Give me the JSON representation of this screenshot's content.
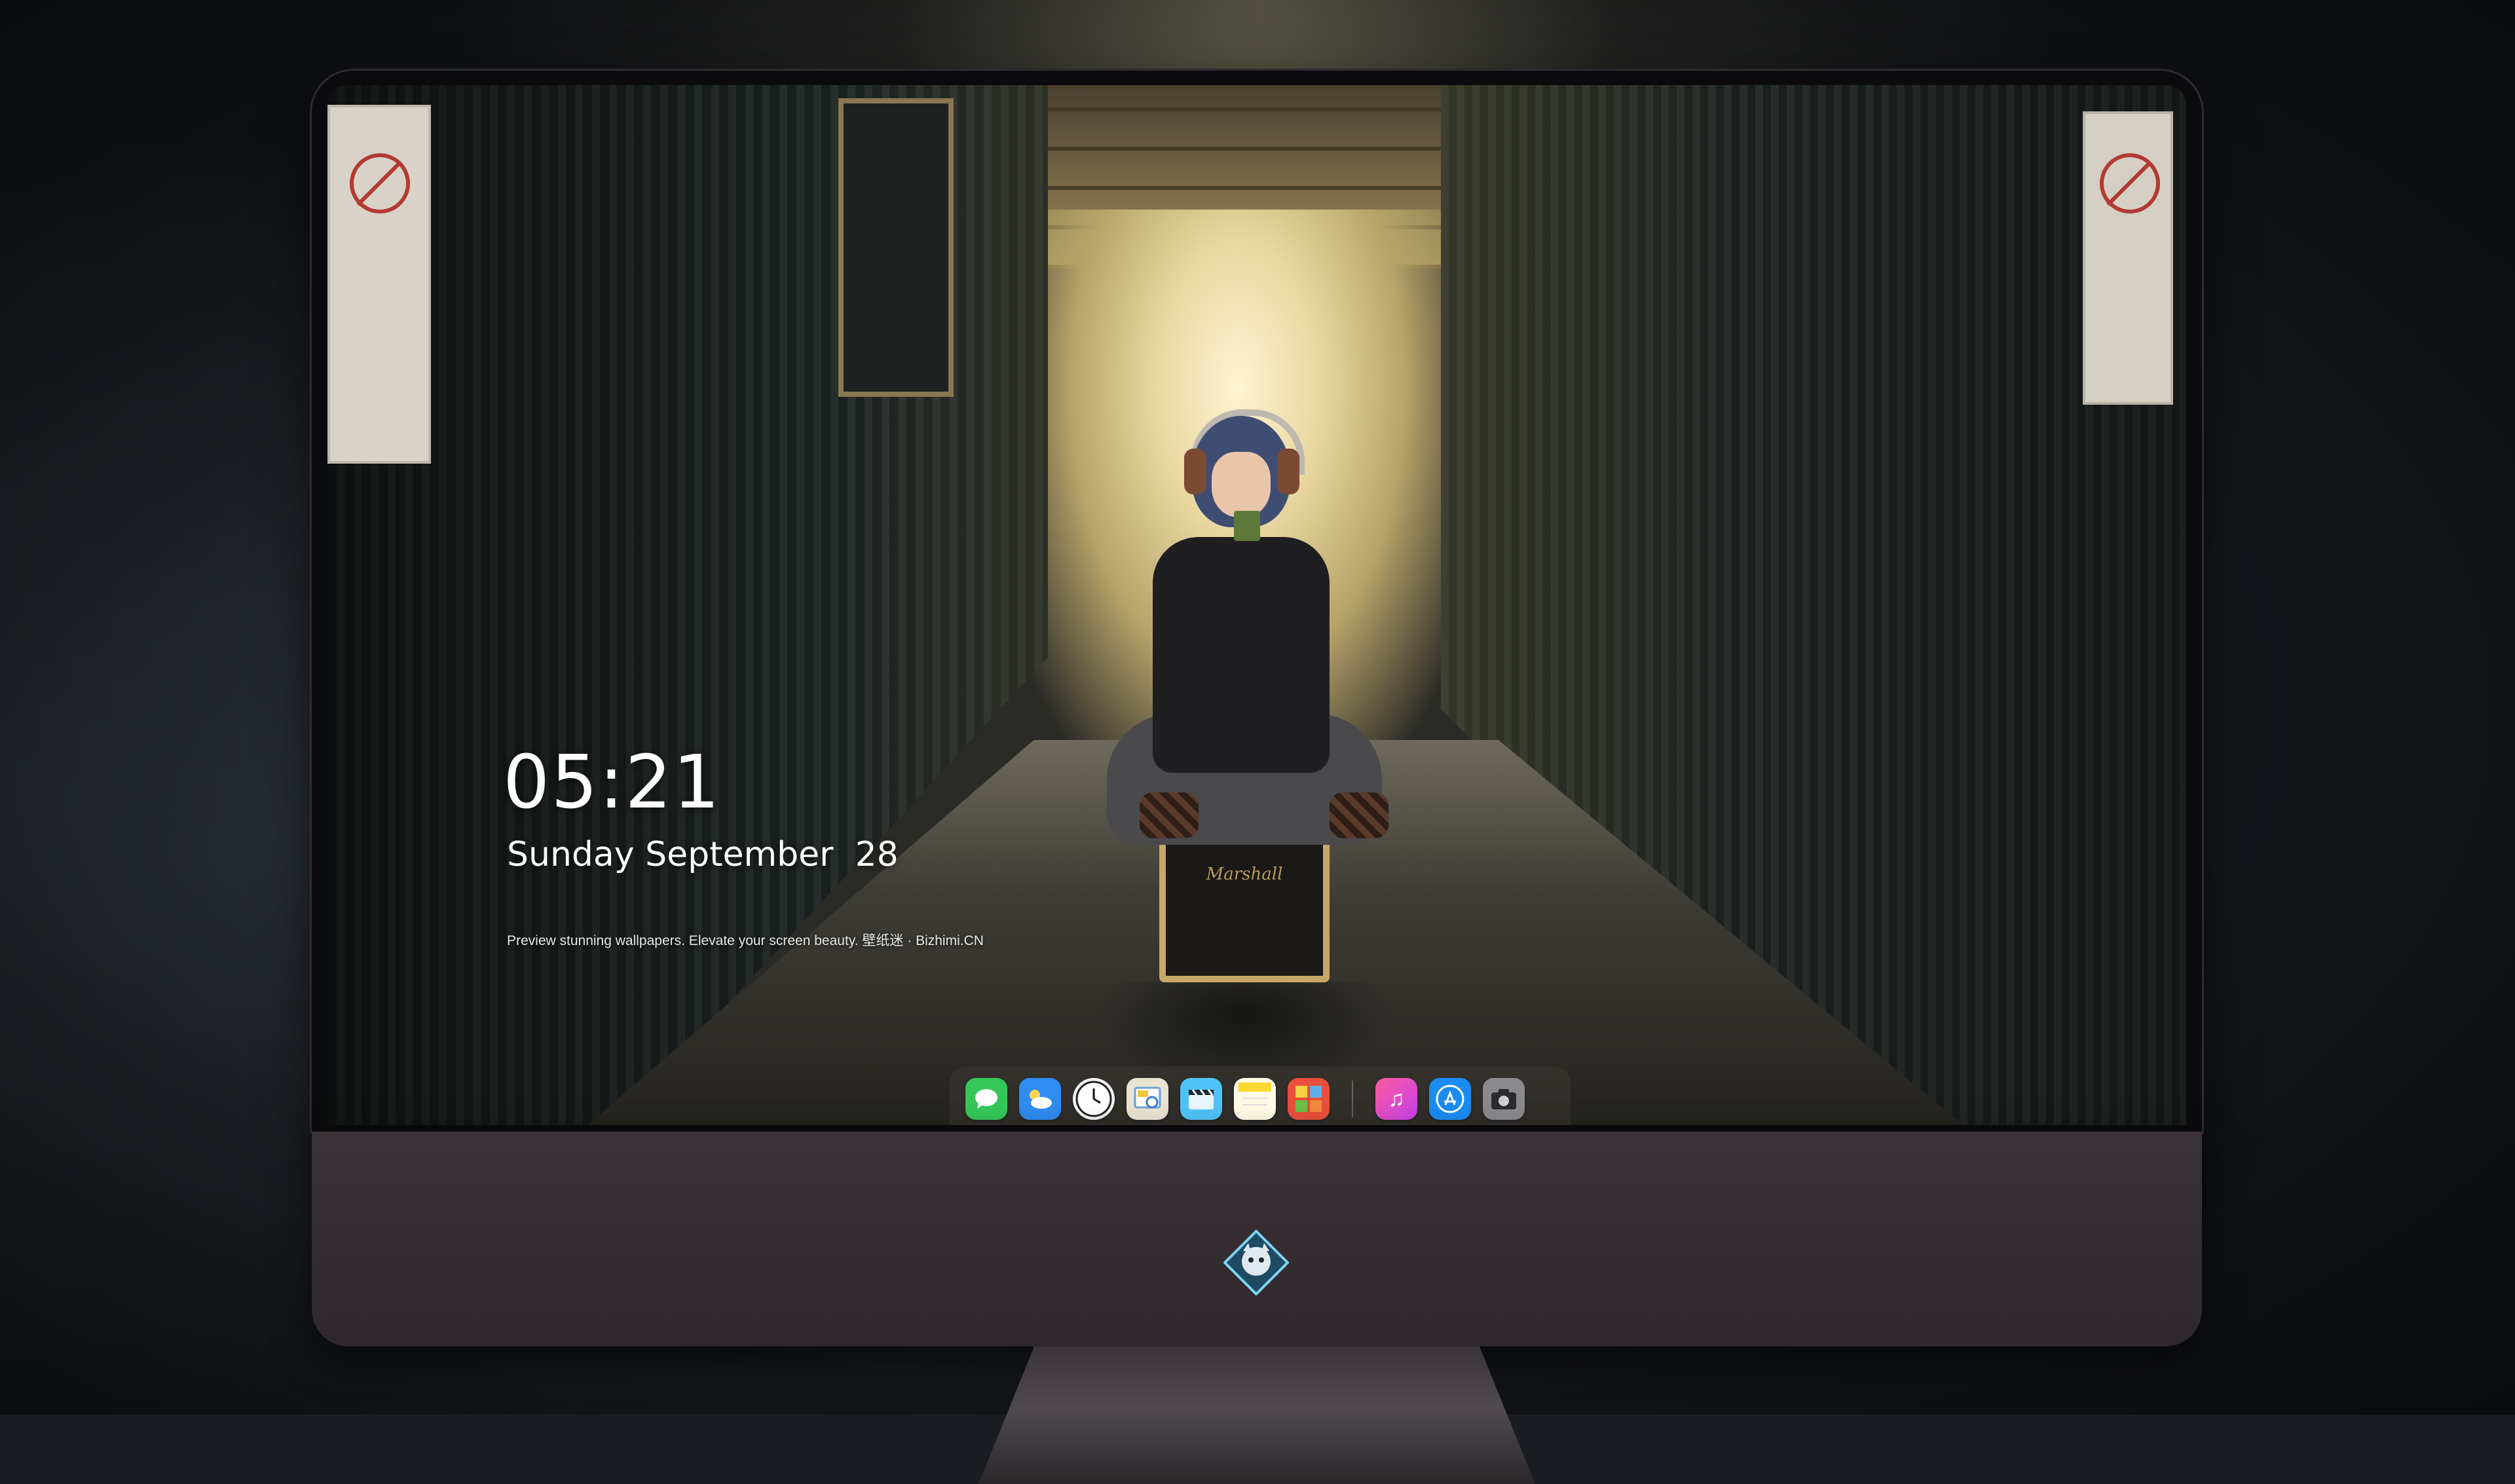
{
  "lockscreen": {
    "time": "05:21",
    "date": "Sunday September  28",
    "caption": "Preview stunning wallpapers. Elevate your screen beauty. 壁纸迷 · Bizhimi.CN"
  },
  "wallpaper": {
    "amp_brand": "Marshall"
  },
  "dock": {
    "apps": [
      {
        "name": "Messages",
        "icon": "messages-icon",
        "color": "#35c759"
      },
      {
        "name": "Weather",
        "icon": "weather-icon",
        "color": "#2f8cf0"
      },
      {
        "name": "Clock",
        "icon": "clock-icon",
        "color": "#f2f2f2"
      },
      {
        "name": "Preview",
        "icon": "preview-icon",
        "color": "#e9e4d2"
      },
      {
        "name": "Clips",
        "icon": "clapperboard-icon",
        "color": "#4fc3f7"
      },
      {
        "name": "Notes",
        "icon": "notes-icon",
        "color": "#fdd835"
      },
      {
        "name": "Photo Booth",
        "icon": "photo-booth-icon",
        "color": "#e94f3b"
      },
      {
        "name": "Music",
        "icon": "music-icon",
        "color": "#fa4d8d"
      },
      {
        "name": "App Store",
        "icon": "app-store-icon",
        "color": "#1b8cf2"
      },
      {
        "name": "Camera",
        "icon": "camera-icon",
        "color": "#8a8a8e"
      }
    ]
  },
  "colors": {
    "chin": "#3a3237",
    "bezel": "#0b0b0d",
    "dock_background": "rgba(60,56,52,0.55)"
  }
}
